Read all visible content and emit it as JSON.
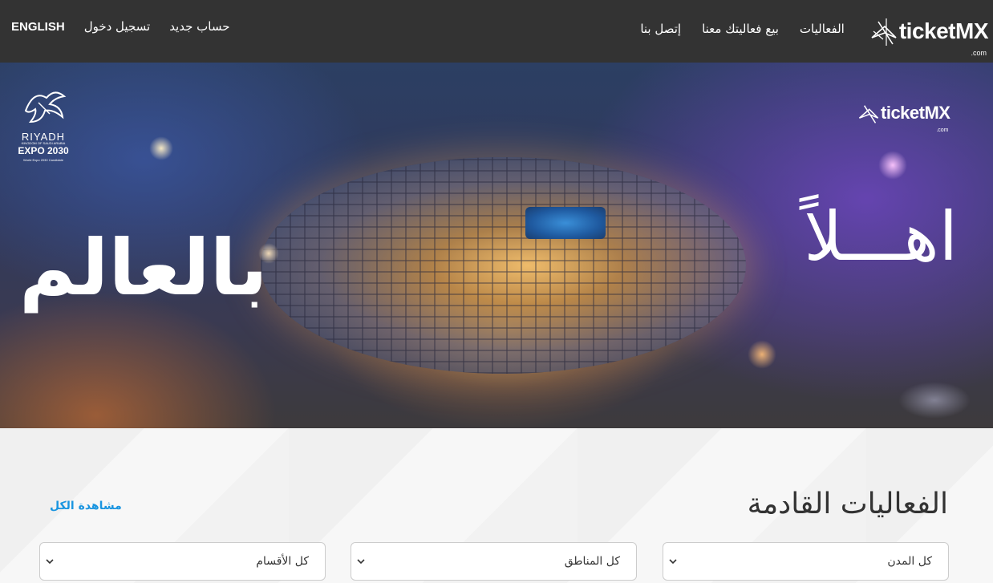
{
  "header": {
    "logo_text": "ticketMX",
    "logo_suffix": ".com",
    "nav_right": [
      {
        "label": "الفعاليات"
      },
      {
        "label": "بيع فعاليتك معنا"
      },
      {
        "label": "إتصل بنا"
      }
    ],
    "nav_left": [
      {
        "label": "حساب جديد"
      },
      {
        "label": "تسجيل دخول"
      },
      {
        "label": "ENGLISH"
      }
    ]
  },
  "hero": {
    "welcome_text": "اهـــلاً",
    "world_text": "بالعالم",
    "logo_text": "ticketMX",
    "logo_suffix": ".com",
    "expo": {
      "city": "RIYADH",
      "subtitle": "KINGDOM OF SAUDI ARABIA",
      "title": "EXPO 2030",
      "small": "World Expo 2030 Candidate"
    }
  },
  "events": {
    "title": "الفعاليات القادمة",
    "view_all": "مشاهدة الكل",
    "filters": {
      "cities": "كل المدن",
      "regions": "كل المناطق",
      "categories": "كل الأقسام"
    }
  },
  "icons": {
    "logo": "ticketmx-logo-icon",
    "dropdown": "chevron-down-icon"
  }
}
